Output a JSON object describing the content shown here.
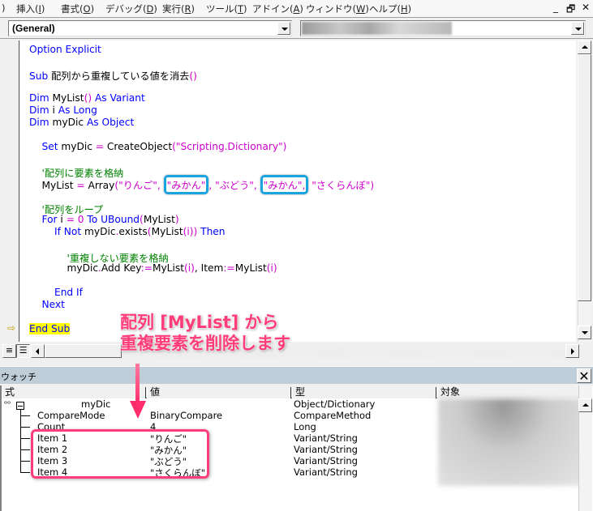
{
  "menubar": {
    "items": [
      {
        "label": ")",
        "shortcut": ""
      },
      {
        "label": "挿入(",
        "shortcut": "I",
        "suffix": ")"
      },
      {
        "label": "書式(",
        "shortcut": "O",
        "suffix": ")"
      },
      {
        "label": "デバッグ(",
        "shortcut": "D",
        "suffix": ")"
      },
      {
        "label": "実行(",
        "shortcut": "R",
        "suffix": ")"
      },
      {
        "label": "ツール(",
        "shortcut": "T",
        "suffix": ")"
      },
      {
        "label": "アドイン(",
        "shortcut": "A",
        "suffix": ")"
      },
      {
        "label": "ウィンドウ(",
        "shortcut": "W",
        "suffix": ")"
      },
      {
        "label": "ヘルプ(",
        "shortcut": "H",
        "suffix": ")"
      }
    ],
    "minimize": "_",
    "restore": "🗗",
    "close": "✕"
  },
  "object_combo": {
    "value": "(General)"
  },
  "procedure_combo": {
    "value": ""
  },
  "code": {
    "lines": [
      {
        "parts": [
          {
            "t": "Option Explicit",
            "c": "kw"
          }
        ]
      },
      {
        "parts": [
          {
            "t": "Sub ",
            "c": "kw"
          },
          {
            "t": "配列から重複している値を消去",
            "c": ""
          },
          {
            "t": "()",
            "c": "op"
          }
        ]
      },
      {
        "parts": [
          {
            "t": "Dim ",
            "c": "kw"
          },
          {
            "t": "MyList",
            "c": ""
          },
          {
            "t": "()",
            "c": "op"
          },
          {
            "t": " As Variant",
            "c": "kw"
          }
        ]
      },
      {
        "parts": [
          {
            "t": "Dim ",
            "c": "kw"
          },
          {
            "t": "i",
            "c": ""
          },
          {
            "t": " As Long",
            "c": "kw"
          }
        ]
      },
      {
        "parts": [
          {
            "t": "Dim ",
            "c": "kw"
          },
          {
            "t": "myDic",
            "c": ""
          },
          {
            "t": " As Object",
            "c": "kw"
          }
        ]
      },
      {
        "parts": [
          {
            "t": "    Set ",
            "c": "kw"
          },
          {
            "t": "myDic ",
            "c": ""
          },
          {
            "t": "=",
            "c": "op"
          },
          {
            "t": " CreateObject",
            "c": ""
          },
          {
            "t": "(\"Scripting.Dictionary\")",
            "c": "str"
          }
        ]
      },
      {
        "parts": [
          {
            "t": "    '配列に要素を格納",
            "c": "cm"
          }
        ]
      },
      {
        "parts": [
          {
            "t": "    MyList ",
            "c": ""
          },
          {
            "t": "=",
            "c": "op"
          },
          {
            "t": " Array",
            "c": ""
          },
          {
            "t": "(\"りんご\", ",
            "c": "str"
          },
          {
            "t": "\"みかん\"",
            "c": "str",
            "hl": true
          },
          {
            "t": ", \"ぶどう\", ",
            "c": "str"
          },
          {
            "t": "\"みかん\",",
            "c": "str",
            "hl": true
          },
          {
            "t": " \"さくらんぼ\")",
            "c": "str"
          }
        ]
      },
      {
        "parts": [
          {
            "t": "    '配列をループ",
            "c": "cm"
          }
        ]
      },
      {
        "parts": [
          {
            "t": "    For ",
            "c": "kw"
          },
          {
            "t": "i ",
            "c": ""
          },
          {
            "t": "= 0",
            "c": "op"
          },
          {
            "t": " To ",
            "c": "kw"
          },
          {
            "t": "UBound",
            "c": "kw"
          },
          {
            "t": "(",
            "c": "op"
          },
          {
            "t": "MyList",
            "c": ""
          },
          {
            "t": ")",
            "c": "op"
          }
        ]
      },
      {
        "parts": [
          {
            "t": "        If Not ",
            "c": "kw"
          },
          {
            "t": "myDic",
            "c": ""
          },
          {
            "t": ".",
            "c": "op"
          },
          {
            "t": "exists",
            "c": ""
          },
          {
            "t": "(",
            "c": "op"
          },
          {
            "t": "MyList",
            "c": ""
          },
          {
            "t": "(i))",
            "c": "op"
          },
          {
            "t": " Then",
            "c": "kw"
          }
        ]
      },
      {
        "parts": [
          {
            "t": "            '重複しない要素を格納",
            "c": "cm"
          }
        ]
      },
      {
        "parts": [
          {
            "t": "            myDic",
            "c": ""
          },
          {
            "t": ".",
            "c": "op"
          },
          {
            "t": "Add Key",
            "c": ""
          },
          {
            "t": ":=",
            "c": "op"
          },
          {
            "t": "MyList",
            "c": ""
          },
          {
            "t": "(i)",
            "c": "op"
          },
          {
            "t": ", Item",
            "c": ""
          },
          {
            "t": ":=",
            "c": "op"
          },
          {
            "t": "MyList",
            "c": ""
          },
          {
            "t": "(i)",
            "c": "op"
          }
        ]
      },
      {
        "parts": [
          {
            "t": "        End If",
            "c": "kw"
          }
        ]
      },
      {
        "parts": [
          {
            "t": "    Next",
            "c": "kw"
          }
        ]
      },
      {
        "parts": [
          {
            "t": "End Sub",
            "c": "kw endsub"
          }
        ]
      }
    ]
  },
  "annotation": {
    "line1": "配列 [MyList] から",
    "line2": "重複要素を削除します",
    "color": "#ff3d7a"
  },
  "watch": {
    "title": "ウォッチ",
    "close": "✕",
    "columns": [
      "式",
      "値",
      "型",
      "対象"
    ],
    "rows": [
      {
        "expr": "myDic",
        "value": "",
        "type": "Object/Dictionary"
      },
      {
        "expr": "CompareMode",
        "value": "BinaryCompare",
        "type": "CompareMethod"
      },
      {
        "expr": "Count",
        "value": "4",
        "type": "Long"
      },
      {
        "expr": "Item 1",
        "value": "\"りんご\"",
        "type": "Variant/String"
      },
      {
        "expr": "Item 2",
        "value": "\"みかん\"",
        "type": "Variant/String"
      },
      {
        "expr": "Item 3",
        "value": "\"ぶどう\"",
        "type": "Variant/String"
      },
      {
        "expr": "Item 4",
        "value": "\"さくらんぼ\"",
        "type": "Variant/String"
      }
    ]
  },
  "colors": {
    "keyword": "#0000ff",
    "string": "#cc00cc",
    "comment": "#008000",
    "highlight_box": "#1aa5e0",
    "watch_titlebar": "#bfcdd9",
    "current_line": "#ffff00"
  }
}
